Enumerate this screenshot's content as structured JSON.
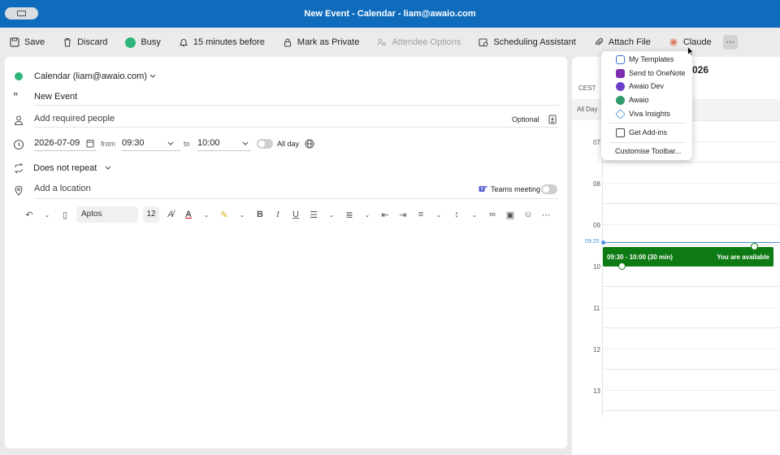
{
  "window": {
    "title": "New Event - Calendar - liam@awaio.com"
  },
  "toolbar": {
    "save": "Save",
    "discard": "Discard",
    "busy": "Busy",
    "reminder": "15 minutes before",
    "private": "Mark as Private",
    "attendee_options": "Attendee Options",
    "scheduling": "Scheduling Assistant",
    "attach": "Attach File",
    "claude": "Claude",
    "more": "···"
  },
  "form": {
    "calendar": "Calendar (liam@awaio.com)",
    "title": "New Event",
    "people_placeholder": "Add required people",
    "optional": "Optional",
    "date": "2026-07-09",
    "from_label": "from",
    "from_time": "09:30",
    "to_label": "to",
    "to_time": "10:00",
    "all_day": "All day",
    "repeat": "Does not repeat",
    "location_placeholder": "Add a location",
    "teams": "Teams meeting",
    "font": "Aptos",
    "font_size": "12"
  },
  "calendar_pane": {
    "title_fragment": "026",
    "timezone": "CEST",
    "all_day": "All Day",
    "hours": [
      "07",
      "08",
      "09",
      "10",
      "11",
      "12",
      "13"
    ],
    "now_time": "09:25",
    "event_time": "09:30 - 10:00 (30 min)",
    "event_status": "You are available"
  },
  "menu": {
    "items": [
      {
        "label": "My Templates",
        "icon": "templates-icon",
        "color": "#3b6fd8"
      },
      {
        "label": "Send to OneNote",
        "icon": "onenote-icon",
        "color": "#7b2fb0"
      },
      {
        "label": "Awaio Dev",
        "icon": "awaio-dev-icon",
        "color": "#6a3fc8"
      },
      {
        "label": "Awaio",
        "icon": "awaio-icon",
        "color": "#2f9a6a"
      },
      {
        "label": "Viva Insights",
        "icon": "viva-insights-icon",
        "color": "#3b8fd8"
      }
    ],
    "get_addins": "Get Add-ins",
    "customise": "Customise Toolbar..."
  },
  "colors": {
    "accent": "#0f6cbd",
    "busy": "#2fb47c",
    "event": "#0e7a14"
  }
}
